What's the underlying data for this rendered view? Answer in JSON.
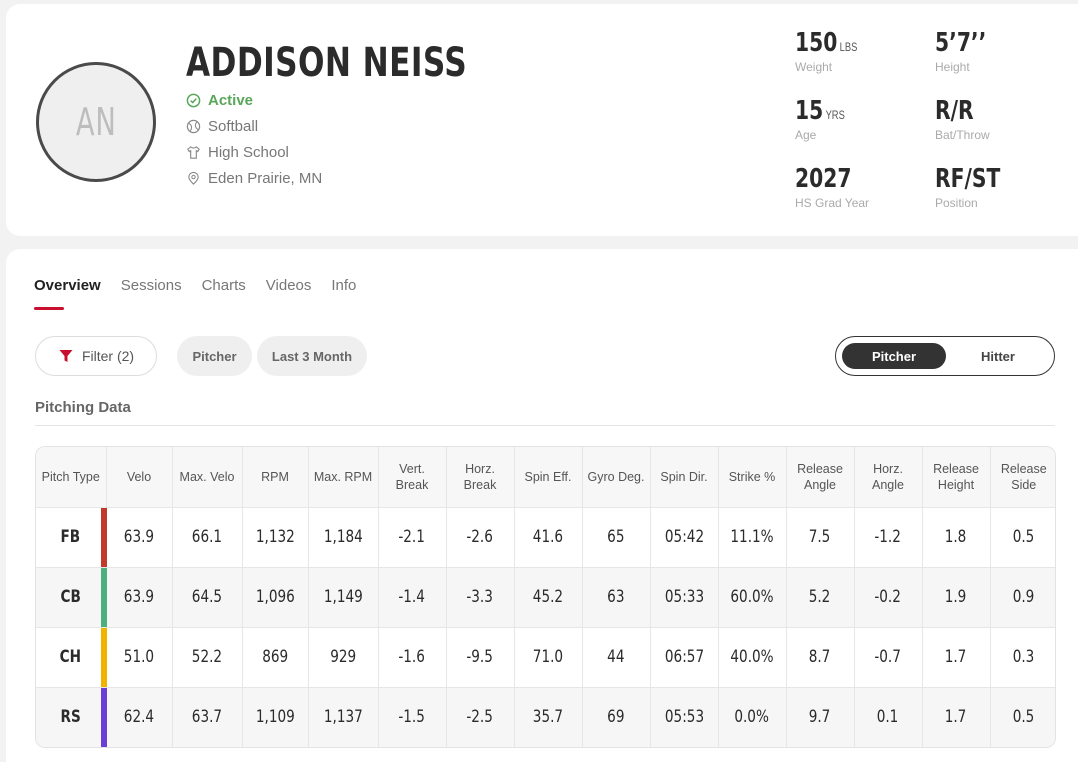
{
  "player": {
    "initials": "AN",
    "name": "ADDISON NEISS",
    "status": "Active",
    "sport": "Softball",
    "level": "High School",
    "location": "Eden Prairie, MN"
  },
  "stats": [
    {
      "value": "150",
      "unit": "LBS",
      "label": "Weight"
    },
    {
      "value": "5’7’’",
      "unit": "",
      "label": "Height"
    },
    {
      "value": "15",
      "unit": "YRS",
      "label": "Age"
    },
    {
      "value": "R/R",
      "unit": "",
      "label": "Bat/Throw"
    },
    {
      "value": "2027",
      "unit": "",
      "label": "HS Grad Year"
    },
    {
      "value": "RF/ST",
      "unit": "",
      "label": "Position"
    }
  ],
  "tabs": [
    "Overview",
    "Sessions",
    "Charts",
    "Videos",
    "Info"
  ],
  "filter_label": "Filter (2)",
  "chips": [
    "Pitcher",
    "Last 3 Month"
  ],
  "toggle": {
    "on": "Pitcher",
    "off": "Hitter"
  },
  "section_title": "Pitching Data",
  "colors": {
    "accent": "#c8102e",
    "active": "#5aa65a"
  },
  "table": {
    "headers": [
      "Pitch Type",
      "Velo",
      "Max. Velo",
      "RPM",
      "Max. RPM",
      "Vert.\nBreak",
      "Horz.\nBreak",
      "Spin Eff.",
      "Gyro Deg.",
      "Spin Dir.",
      "Strike %",
      "Release\nAngle",
      "Horz.\nAngle",
      "Release\nHeight",
      "Release\nSide"
    ],
    "rows": [
      {
        "type": "FB",
        "color": "#c0392b",
        "values": [
          "63.9",
          "66.1",
          "1,132",
          "1,184",
          "-2.1",
          "-2.6",
          "41.6",
          "65",
          "05:42",
          "11.1%",
          "7.5",
          "-1.2",
          "1.8",
          "0.5"
        ]
      },
      {
        "type": "CB",
        "color": "#4caf7d",
        "values": [
          "63.9",
          "64.5",
          "1,096",
          "1,149",
          "-1.4",
          "-3.3",
          "45.2",
          "63",
          "05:33",
          "60.0%",
          "5.2",
          "-0.2",
          "1.9",
          "0.9"
        ]
      },
      {
        "type": "CH",
        "color": "#f0b400",
        "values": [
          "51.0",
          "52.2",
          "869",
          "929",
          "-1.6",
          "-9.5",
          "71.0",
          "44",
          "06:57",
          "40.0%",
          "8.7",
          "-0.7",
          "1.7",
          "0.3"
        ]
      },
      {
        "type": "RS",
        "color": "#6a3fd6",
        "values": [
          "62.4",
          "63.7",
          "1,109",
          "1,137",
          "-1.5",
          "-2.5",
          "35.7",
          "69",
          "05:53",
          "0.0%",
          "9.7",
          "0.1",
          "1.7",
          "0.5"
        ]
      }
    ]
  }
}
